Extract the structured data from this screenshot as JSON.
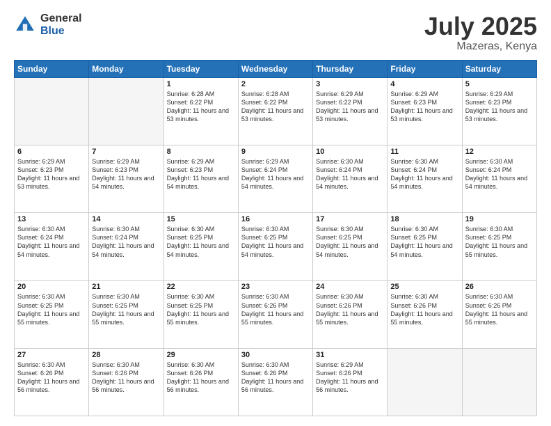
{
  "header": {
    "logo_general": "General",
    "logo_blue": "Blue",
    "title": "July 2025",
    "location": "Mazeras, Kenya"
  },
  "days_of_week": [
    "Sunday",
    "Monday",
    "Tuesday",
    "Wednesday",
    "Thursday",
    "Friday",
    "Saturday"
  ],
  "weeks": [
    [
      {
        "day": "",
        "empty": true
      },
      {
        "day": "",
        "empty": true
      },
      {
        "day": "1",
        "sunrise": "6:28 AM",
        "sunset": "6:22 PM",
        "daylight": "11 hours and 53 minutes."
      },
      {
        "day": "2",
        "sunrise": "6:28 AM",
        "sunset": "6:22 PM",
        "daylight": "11 hours and 53 minutes."
      },
      {
        "day": "3",
        "sunrise": "6:29 AM",
        "sunset": "6:22 PM",
        "daylight": "11 hours and 53 minutes."
      },
      {
        "day": "4",
        "sunrise": "6:29 AM",
        "sunset": "6:23 PM",
        "daylight": "11 hours and 53 minutes."
      },
      {
        "day": "5",
        "sunrise": "6:29 AM",
        "sunset": "6:23 PM",
        "daylight": "11 hours and 53 minutes."
      }
    ],
    [
      {
        "day": "6",
        "sunrise": "6:29 AM",
        "sunset": "6:23 PM",
        "daylight": "11 hours and 53 minutes."
      },
      {
        "day": "7",
        "sunrise": "6:29 AM",
        "sunset": "6:23 PM",
        "daylight": "11 hours and 54 minutes."
      },
      {
        "day": "8",
        "sunrise": "6:29 AM",
        "sunset": "6:23 PM",
        "daylight": "11 hours and 54 minutes."
      },
      {
        "day": "9",
        "sunrise": "6:29 AM",
        "sunset": "6:24 PM",
        "daylight": "11 hours and 54 minutes."
      },
      {
        "day": "10",
        "sunrise": "6:30 AM",
        "sunset": "6:24 PM",
        "daylight": "11 hours and 54 minutes."
      },
      {
        "day": "11",
        "sunrise": "6:30 AM",
        "sunset": "6:24 PM",
        "daylight": "11 hours and 54 minutes."
      },
      {
        "day": "12",
        "sunrise": "6:30 AM",
        "sunset": "6:24 PM",
        "daylight": "11 hours and 54 minutes."
      }
    ],
    [
      {
        "day": "13",
        "sunrise": "6:30 AM",
        "sunset": "6:24 PM",
        "daylight": "11 hours and 54 minutes."
      },
      {
        "day": "14",
        "sunrise": "6:30 AM",
        "sunset": "6:24 PM",
        "daylight": "11 hours and 54 minutes."
      },
      {
        "day": "15",
        "sunrise": "6:30 AM",
        "sunset": "6:25 PM",
        "daylight": "11 hours and 54 minutes."
      },
      {
        "day": "16",
        "sunrise": "6:30 AM",
        "sunset": "6:25 PM",
        "daylight": "11 hours and 54 minutes."
      },
      {
        "day": "17",
        "sunrise": "6:30 AM",
        "sunset": "6:25 PM",
        "daylight": "11 hours and 54 minutes."
      },
      {
        "day": "18",
        "sunrise": "6:30 AM",
        "sunset": "6:25 PM",
        "daylight": "11 hours and 54 minutes."
      },
      {
        "day": "19",
        "sunrise": "6:30 AM",
        "sunset": "6:25 PM",
        "daylight": "11 hours and 55 minutes."
      }
    ],
    [
      {
        "day": "20",
        "sunrise": "6:30 AM",
        "sunset": "6:25 PM",
        "daylight": "11 hours and 55 minutes."
      },
      {
        "day": "21",
        "sunrise": "6:30 AM",
        "sunset": "6:25 PM",
        "daylight": "11 hours and 55 minutes."
      },
      {
        "day": "22",
        "sunrise": "6:30 AM",
        "sunset": "6:25 PM",
        "daylight": "11 hours and 55 minutes."
      },
      {
        "day": "23",
        "sunrise": "6:30 AM",
        "sunset": "6:26 PM",
        "daylight": "11 hours and 55 minutes."
      },
      {
        "day": "24",
        "sunrise": "6:30 AM",
        "sunset": "6:26 PM",
        "daylight": "11 hours and 55 minutes."
      },
      {
        "day": "25",
        "sunrise": "6:30 AM",
        "sunset": "6:26 PM",
        "daylight": "11 hours and 55 minutes."
      },
      {
        "day": "26",
        "sunrise": "6:30 AM",
        "sunset": "6:26 PM",
        "daylight": "11 hours and 55 minutes."
      }
    ],
    [
      {
        "day": "27",
        "sunrise": "6:30 AM",
        "sunset": "6:26 PM",
        "daylight": "11 hours and 56 minutes."
      },
      {
        "day": "28",
        "sunrise": "6:30 AM",
        "sunset": "6:26 PM",
        "daylight": "11 hours and 56 minutes."
      },
      {
        "day": "29",
        "sunrise": "6:30 AM",
        "sunset": "6:26 PM",
        "daylight": "11 hours and 56 minutes."
      },
      {
        "day": "30",
        "sunrise": "6:30 AM",
        "sunset": "6:26 PM",
        "daylight": "11 hours and 56 minutes."
      },
      {
        "day": "31",
        "sunrise": "6:29 AM",
        "sunset": "6:26 PM",
        "daylight": "11 hours and 56 minutes."
      },
      {
        "day": "",
        "empty": true
      },
      {
        "day": "",
        "empty": true
      }
    ]
  ]
}
